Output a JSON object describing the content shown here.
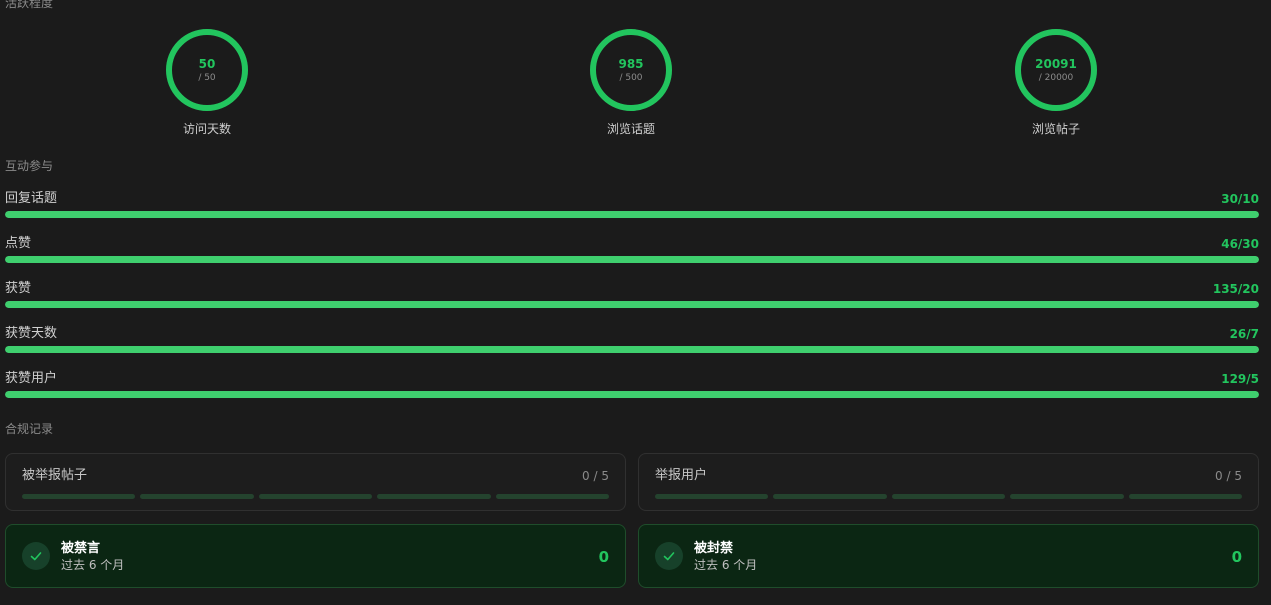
{
  "sections": {
    "activity": "活跃程度",
    "engagement": "互动参与",
    "compliance": "合规记录"
  },
  "rings": [
    {
      "value": "50",
      "target": "/ 50",
      "label": "访问天数",
      "progress": 1.0
    },
    {
      "value": "985",
      "target": "/ 500",
      "label": "浏览话题",
      "progress": 1.0
    },
    {
      "value": "20091",
      "target": "/ 20000",
      "label": "浏览帖子",
      "progress": 1.0
    }
  ],
  "metrics": [
    {
      "label": "回复话题",
      "value": "30/10",
      "progress": 1.0
    },
    {
      "label": "点赞",
      "value": "46/30",
      "progress": 1.0
    },
    {
      "label": "获赞",
      "value": "135/20",
      "progress": 1.0
    },
    {
      "label": "获赞天数",
      "value": "26/7",
      "progress": 1.0
    },
    {
      "label": "获赞用户",
      "value": "129/5",
      "progress": 1.0
    }
  ],
  "reports": [
    {
      "label": "被举报帖子",
      "count": "0 / 5",
      "filled": 0,
      "segments": 5
    },
    {
      "label": "举报用户",
      "count": "0 / 5",
      "filled": 0,
      "segments": 5
    }
  ],
  "statuses": [
    {
      "title": "被禁言",
      "subtitle": "过去 6 个月",
      "value": "0"
    },
    {
      "title": "被封禁",
      "subtitle": "过去 6 个月",
      "value": "0"
    }
  ],
  "colors": {
    "accent": "#22c55e",
    "bar": "#3fcf6e",
    "background": "#1b1b1b"
  },
  "icons": {
    "status": "check-icon"
  }
}
